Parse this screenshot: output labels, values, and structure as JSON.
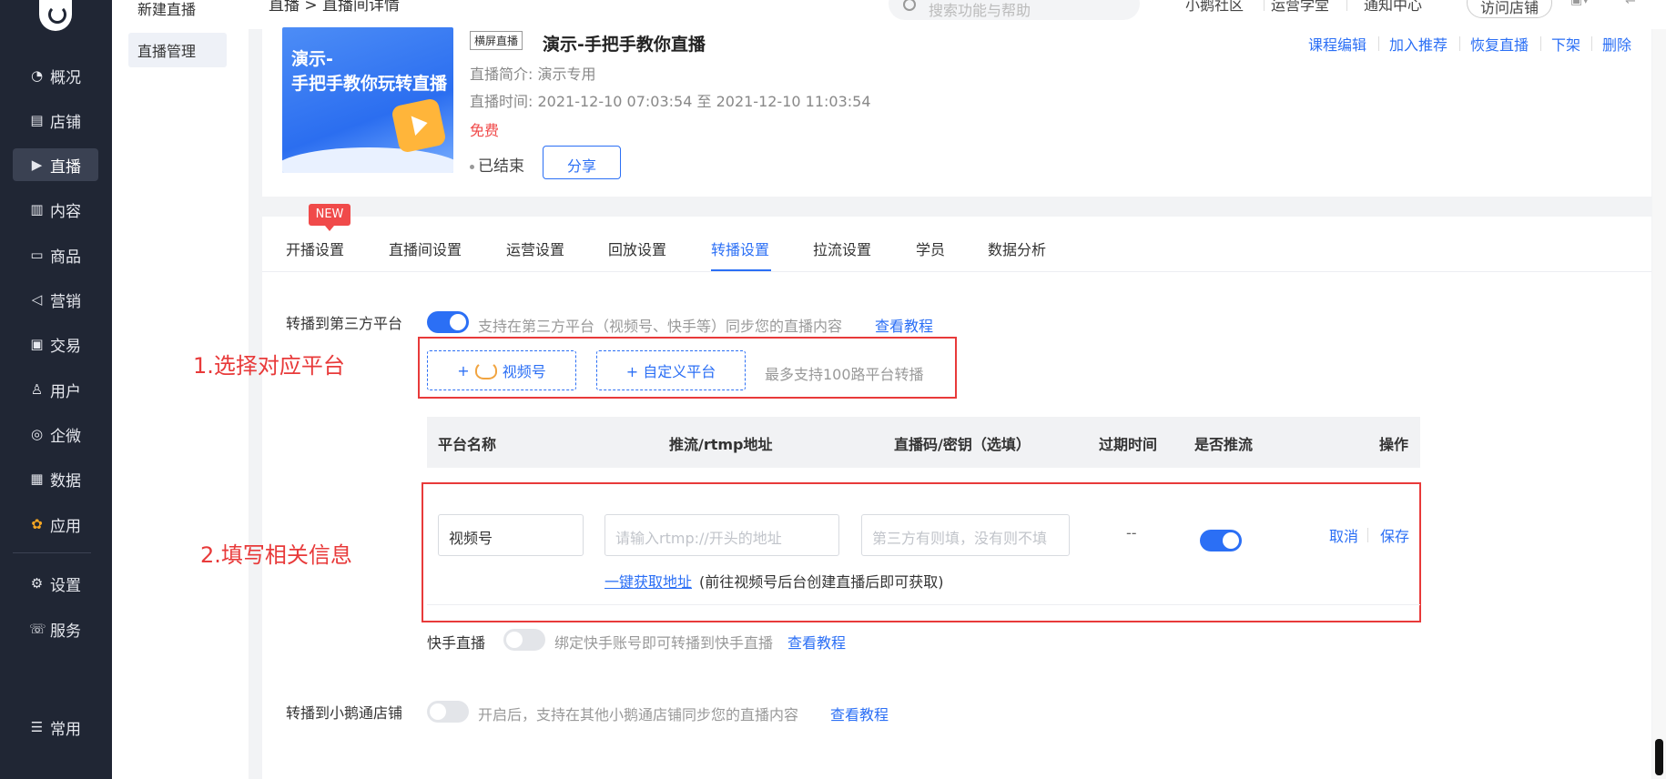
{
  "nav": {
    "items": [
      {
        "label": "概况",
        "icon": "clock-icon"
      },
      {
        "label": "店铺",
        "icon": "store-icon"
      },
      {
        "label": "直播",
        "icon": "video-icon"
      },
      {
        "label": "内容",
        "icon": "document-icon"
      },
      {
        "label": "商品",
        "icon": "box-icon"
      },
      {
        "label": "营销",
        "icon": "megaphone-icon"
      },
      {
        "label": "交易",
        "icon": "receipt-icon"
      },
      {
        "label": "用户",
        "icon": "user-icon"
      },
      {
        "label": "企微",
        "icon": "chat-icon"
      },
      {
        "label": "数据",
        "icon": "chart-icon"
      },
      {
        "label": "应用",
        "icon": "apps-icon"
      },
      {
        "label": "设置",
        "icon": "gear-icon"
      },
      {
        "label": "服务",
        "icon": "service-icon"
      },
      {
        "label": "常用",
        "icon": "list-icon"
      }
    ],
    "active": "直播"
  },
  "subnav": {
    "items": [
      "新建直播",
      "直播管理"
    ],
    "active": "直播管理"
  },
  "header": {
    "breadcrumb": "直播 > 直播间详情",
    "search_placeholder": "搜索功能与帮助",
    "links": [
      "小鹅社区",
      "运营学堂",
      "通知中心"
    ],
    "visit_store": "访问店铺"
  },
  "live": {
    "cover_text": "演示-\n手把手教你玩转直播",
    "tag": "横屏直播",
    "title": "演示-手把手教你直播",
    "intro": "直播简介: 演示专用",
    "time": "直播时间: 2021-12-10 07:03:54 至 2021-12-10 11:03:54",
    "price": "免费",
    "status": "已结束",
    "share": "分享",
    "actions": [
      "课程编辑",
      "加入推荐",
      "恢复直播",
      "下架",
      "删除"
    ]
  },
  "tabs": {
    "items": [
      "开播设置",
      "直播间设置",
      "运营设置",
      "回放设置",
      "转播设置",
      "拉流设置",
      "学员",
      "数据分析"
    ],
    "active": "转播设置",
    "new_badge": "NEW"
  },
  "relay": {
    "third_party_label": "转播到第三方平台",
    "third_party_hint": "支持在第三方平台（视频号、快手等）同步您的直播内容",
    "tutorial": "查看教程",
    "third_party_on": true,
    "wechat_btn": "视频号",
    "custom_btn": "+ 自定义平台",
    "max_hint": "最多支持100路平台转播",
    "annotation1": "1.选择对应平台",
    "annotation2": "2.填写相关信息",
    "table": {
      "headers": [
        "平台名称",
        "推流/rtmp地址",
        "直播码/密钥（选填）",
        "过期时间",
        "是否推流",
        "操作"
      ],
      "row": {
        "platform": "视频号",
        "rtmp_placeholder": "请输入rtmp://开头的地址",
        "key_placeholder": "第三方有则填，没有则不填",
        "expire": "--",
        "push_on": true,
        "cancel": "取消",
        "save": "保存",
        "get_link": "一键获取地址",
        "get_hint": "(前往视频号后台创建直播后即可获取)"
      }
    },
    "kuaishou_label": "快手直播",
    "kuaishou_hint": "绑定快手账号即可转播到快手直播",
    "kuaishou_on": false,
    "store_label": "转播到小鹅通店铺",
    "store_hint": "开启后，支持在其他小鹅通店铺同步您的直播内容",
    "store_on": false
  },
  "colors": {
    "accent": "#2b6ff5",
    "annotation": "#e83a3a",
    "nav_bg": "#202634"
  }
}
